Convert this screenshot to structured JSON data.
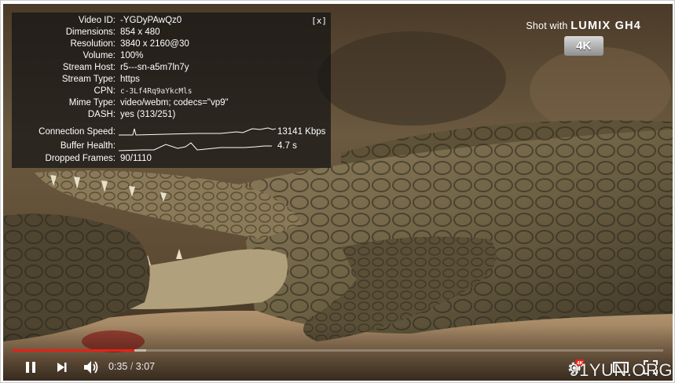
{
  "stats": {
    "close_label": "[x]",
    "rows": [
      {
        "label": "Video ID:",
        "value": "-YGDyPAwQz0"
      },
      {
        "label": "Dimensions:",
        "value": "854 x 480"
      },
      {
        "label": "Resolution:",
        "value": "3840 x 2160@30"
      },
      {
        "label": "Volume:",
        "value": "100%"
      },
      {
        "label": "Stream Host:",
        "value": "r5---sn-a5m7ln7y"
      },
      {
        "label": "Stream Type:",
        "value": "https"
      },
      {
        "label": "CPN:",
        "value": "c-3Lf4Rq9aYkcMls"
      },
      {
        "label": "Mime Type:",
        "value": "video/webm; codecs=\"vp9\""
      },
      {
        "label": "DASH:",
        "value": "yes (313/251)"
      }
    ],
    "connection_speed": {
      "label": "Connection Speed:",
      "value": "13141 Kbps"
    },
    "buffer_health": {
      "label": "Buffer Health:",
      "value": "4.7 s"
    },
    "dropped_frames": {
      "label": "Dropped Frames:",
      "value": "90/1110"
    }
  },
  "watermark": {
    "prefix": "Shot with ",
    "brand": "LUMIX GH4",
    "badge": "4K"
  },
  "controls": {
    "current_time": "0:35",
    "separator": " / ",
    "duration": "3:07",
    "played_fraction": 0.187,
    "buffered_fraction": 0.205,
    "hd_badge": "4K"
  },
  "site_watermark": "91YUN.ORG",
  "colors": {
    "progress": "#e62117",
    "hd_badge": "#e62117"
  }
}
